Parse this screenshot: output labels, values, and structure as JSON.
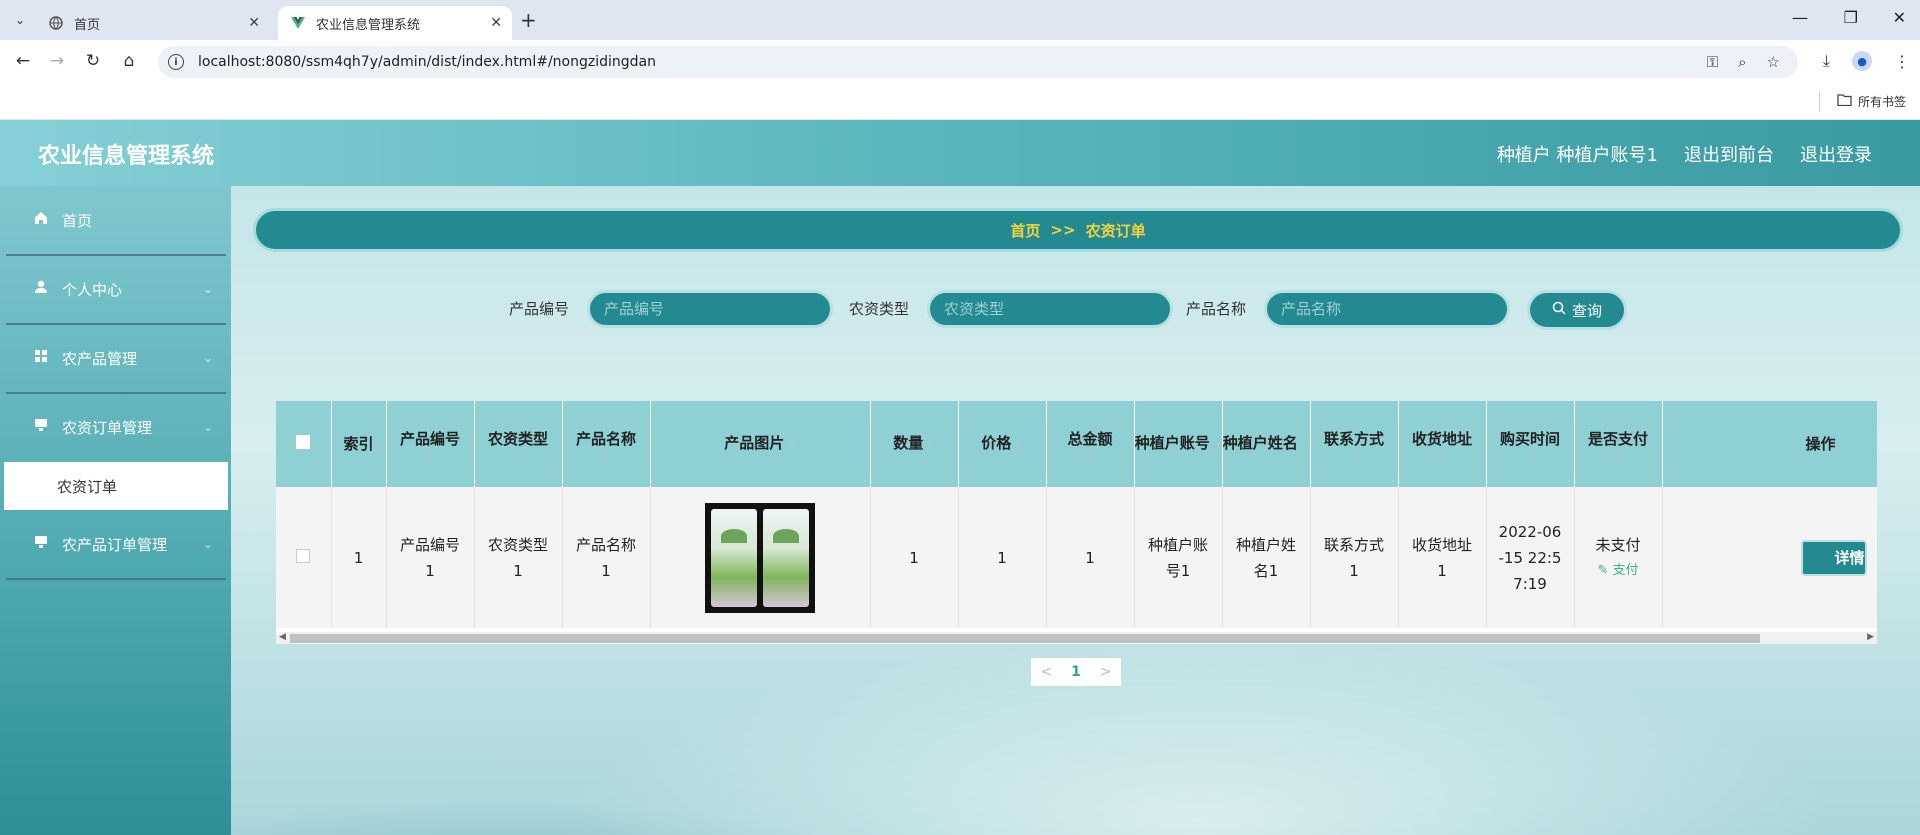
{
  "browser": {
    "tabs": [
      {
        "title": "首页",
        "active": false
      },
      {
        "title": "农业信息管理系统",
        "active": true
      }
    ],
    "url": "localhost:8080/ssm4qh7y/admin/dist/index.html#/nongzidingdan",
    "bookmark_label": "所有书签"
  },
  "app": {
    "title": "农业信息管理系统",
    "header_links": {
      "user": "种植户 种植户账号1",
      "front": "退出到前台",
      "logout": "退出登录"
    }
  },
  "sidebar": {
    "items": [
      {
        "label": "首页",
        "icon": "home-icon"
      },
      {
        "label": "个人中心",
        "icon": "user-icon"
      },
      {
        "label": "农产品管理",
        "icon": "grid-icon"
      },
      {
        "label": "农资订单管理",
        "icon": "monitor-icon"
      },
      {
        "label": "农产品订单管理",
        "icon": "monitor-icon"
      }
    ],
    "submenu_active": "农资订单"
  },
  "breadcrumb": {
    "home": "首页",
    "sep": ">>",
    "current": "农资订单"
  },
  "search": {
    "fields": [
      {
        "label": "产品编号",
        "placeholder": "产品编号"
      },
      {
        "label": "农资类型",
        "placeholder": "农资类型"
      },
      {
        "label": "产品名称",
        "placeholder": "产品名称"
      }
    ],
    "button": "查询"
  },
  "table": {
    "headers": {
      "index": "索引",
      "code": "产品编号",
      "type": "农资类型",
      "name": "产品名称",
      "image": "产品图片",
      "qty": "数量",
      "price": "价格",
      "total": "总金额",
      "account": "种植户账号",
      "person": "种植户姓名",
      "contact": "联系方式",
      "address": "收货地址",
      "time": "购买时间",
      "paid": "是否支付",
      "action": "操作"
    },
    "rows": [
      {
        "index": "1",
        "code": "产品编号1",
        "type": "农资类型1",
        "name": "产品名称1",
        "qty": "1",
        "price": "1",
        "total": "1",
        "account": "种植户账号1",
        "person": "种植户姓名1",
        "contact": "联系方式1",
        "address": "收货地址1",
        "time": "2022-06-15 22:57:19",
        "paid": "未支付",
        "pay_link": "支付",
        "detail": "详情"
      }
    ]
  },
  "pagination": {
    "prev": "<",
    "current": "1",
    "next": ">"
  },
  "colors": {
    "primary": "#238a91",
    "header_cell": "#8fd0d5",
    "breadcrumb_text": "#f6d33a",
    "pay_link": "#38b38a"
  }
}
